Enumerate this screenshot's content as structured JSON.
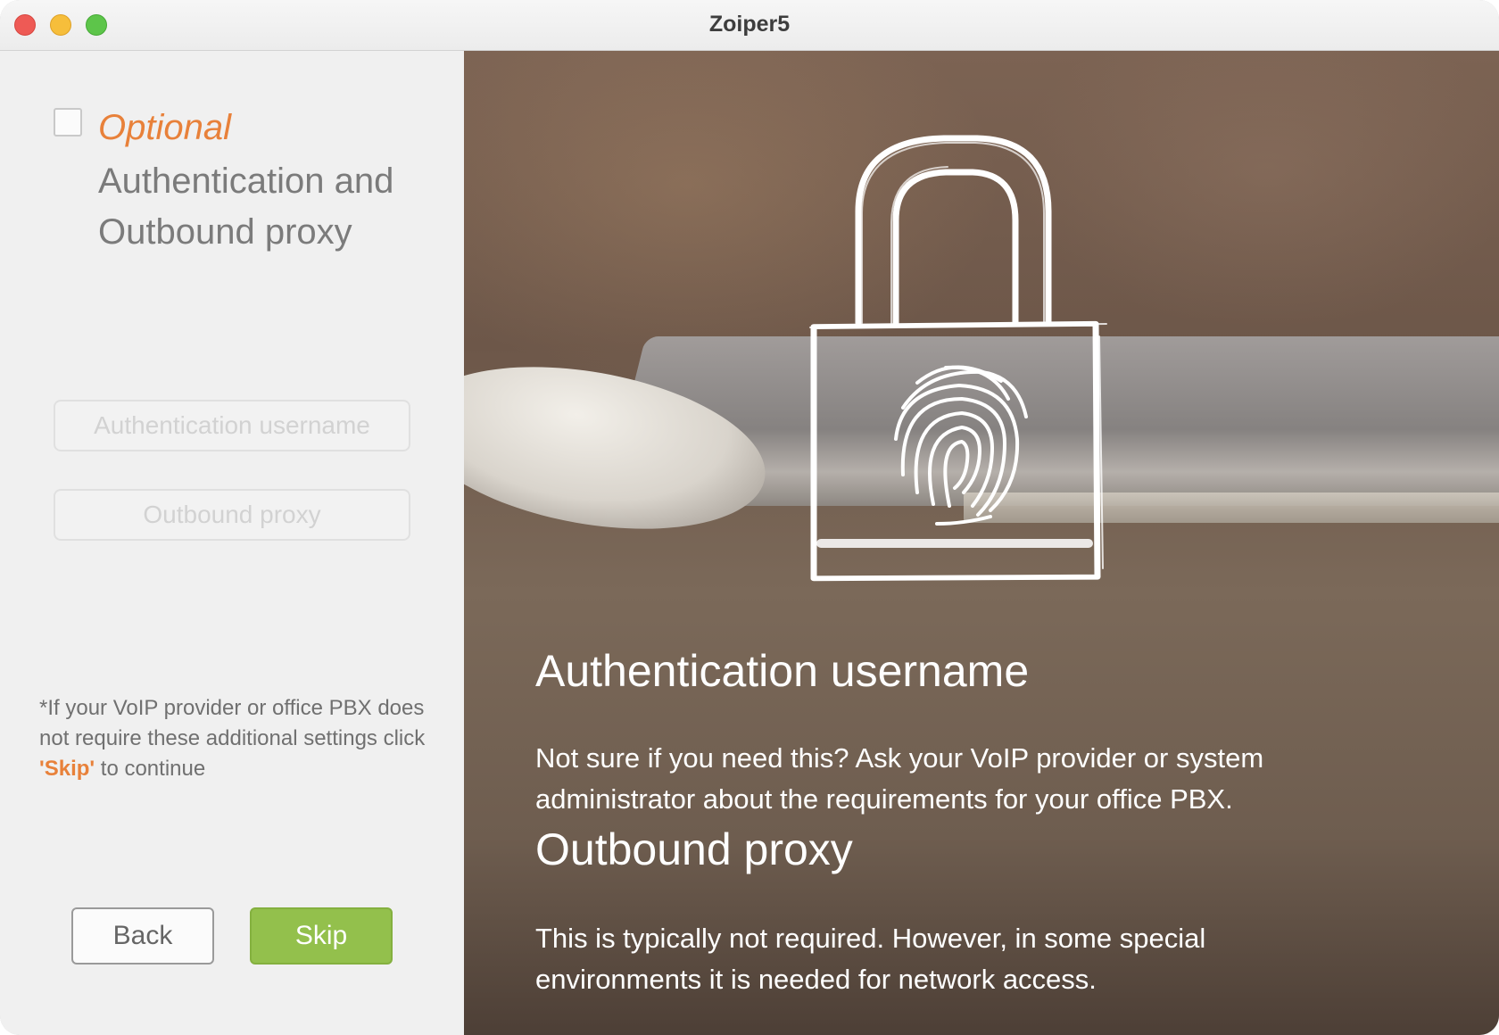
{
  "window": {
    "title": "Zoiper5"
  },
  "left": {
    "optional_label": "Optional",
    "heading": "Authentication and Outbound proxy",
    "auth_username_placeholder": "Authentication username",
    "outbound_proxy_placeholder": "Outbound proxy",
    "note_before": "*If your VoIP provider or office PBX does not require these additional settings click ",
    "note_skip": "'Skip'",
    "note_after": " to continue",
    "back_label": "Back",
    "skip_label": "Skip"
  },
  "right": {
    "auth_heading": "Authentication username",
    "auth_text": "Not sure if you need this? Ask your VoIP provider or system administrator about the requirements for your office PBX.",
    "proxy_heading": "Outbound proxy",
    "proxy_text": "This is typically not required. However, in some special environments it is needed for network access."
  },
  "colors": {
    "accent_orange": "#e8813a",
    "skip_green": "#93c04c"
  },
  "icons": [
    "padlock-fingerprint-icon"
  ]
}
